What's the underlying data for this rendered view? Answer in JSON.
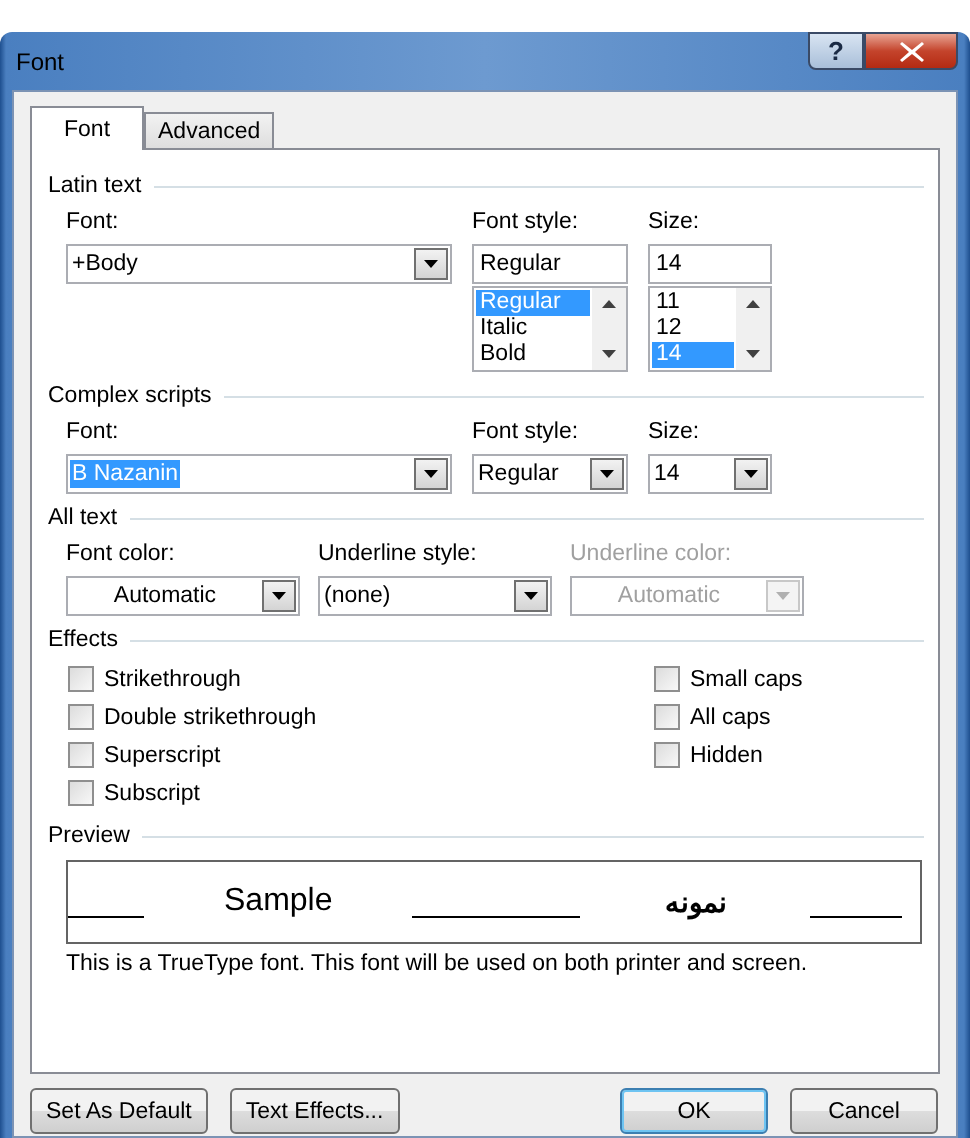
{
  "window": {
    "title": "Font",
    "help_button": "?"
  },
  "tabs": [
    {
      "label": "Font",
      "selected": true
    },
    {
      "label": "Advanced",
      "selected": false
    }
  ],
  "latin_text": {
    "title": "Latin text",
    "font": {
      "label": "Font:",
      "value": "+Body"
    },
    "font_style": {
      "label": "Font style:",
      "value": "Regular",
      "options": [
        {
          "label": "Regular",
          "selected": true
        },
        {
          "label": "Italic",
          "selected": false
        },
        {
          "label": "Bold",
          "selected": false
        }
      ]
    },
    "size": {
      "label": "Size:",
      "value": "14",
      "options": [
        {
          "label": "11",
          "selected": false
        },
        {
          "label": "12",
          "selected": false
        },
        {
          "label": "14",
          "selected": true
        }
      ]
    }
  },
  "complex_scripts": {
    "title": "Complex scripts",
    "font": {
      "label": "Font:",
      "value": "B Nazanin",
      "text_selected": true
    },
    "font_style": {
      "label": "Font style:",
      "value": "Regular",
      "text_selected": false
    },
    "size": {
      "label": "Size:",
      "value": "14",
      "text_selected": false
    }
  },
  "all_text": {
    "title": "All text",
    "font_color": {
      "label": "Font color:",
      "value": "Automatic",
      "disabled": false
    },
    "underline_style": {
      "label": "Underline style:",
      "value": "(none)",
      "disabled": false
    },
    "underline_color": {
      "label": "Underline color:",
      "value": "Automatic",
      "disabled": true
    }
  },
  "effects": {
    "title": "Effects",
    "left": [
      {
        "label": "Strikethrough",
        "checked": false
      },
      {
        "label": "Double strikethrough",
        "checked": false
      },
      {
        "label": "Superscript",
        "checked": false
      },
      {
        "label": "Subscript",
        "checked": false
      }
    ],
    "right": [
      {
        "label": "Small caps",
        "checked": false
      },
      {
        "label": "All caps",
        "checked": false
      },
      {
        "label": "Hidden",
        "checked": false
      }
    ]
  },
  "preview": {
    "title": "Preview",
    "sample_latin": "Sample",
    "sample_complex": "نمونه",
    "note": "This is a TrueType font. This font will be used on both printer and screen."
  },
  "buttons_left": [
    {
      "label": "Set As Default",
      "default": false
    },
    {
      "label": "Text Effects...",
      "default": false
    }
  ],
  "buttons_right": [
    {
      "label": "OK",
      "default": true
    },
    {
      "label": "Cancel",
      "default": false
    }
  ]
}
